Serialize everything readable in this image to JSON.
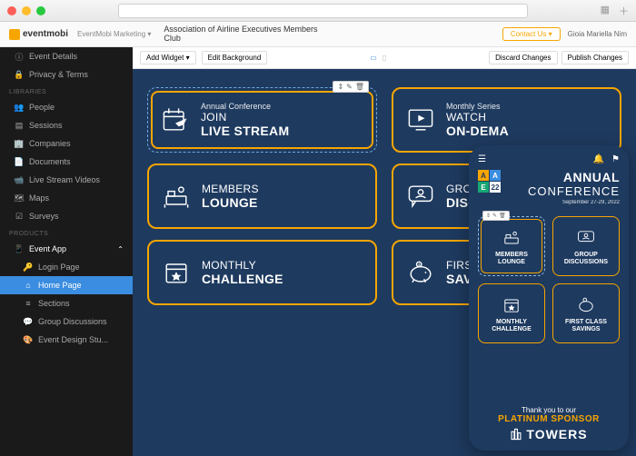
{
  "brand": "eventmobi",
  "breadcrumb": "EventMobi Marketing ▾",
  "event_name": "Association of Airline Executives Members Club",
  "topbar": {
    "contact": "Contact Us ▾",
    "user": "Gioia Mariella Nim"
  },
  "sidebar": {
    "main": [
      {
        "icon": "ⓘ",
        "label": "Event Details"
      },
      {
        "icon": "🔒",
        "label": "Privacy & Terms"
      }
    ],
    "libraries_label": "LIBRARIES",
    "libraries": [
      {
        "icon": "👥",
        "label": "People"
      },
      {
        "icon": "▤",
        "label": "Sessions"
      },
      {
        "icon": "🏢",
        "label": "Companies"
      },
      {
        "icon": "📄",
        "label": "Documents"
      },
      {
        "icon": "📹",
        "label": "Live Stream Videos"
      },
      {
        "icon": "🗺",
        "label": "Maps"
      },
      {
        "icon": "☑",
        "label": "Surveys"
      }
    ],
    "products_label": "PRODUCTS",
    "product_parent": {
      "icon": "📱",
      "label": "Event App"
    },
    "product_children": [
      {
        "icon": "🔑",
        "label": "Login Page",
        "active": false
      },
      {
        "icon": "⌂",
        "label": "Home Page",
        "active": true
      },
      {
        "icon": "≡",
        "label": "Sections",
        "active": false
      },
      {
        "icon": "💬",
        "label": "Group Discussions",
        "active": false
      },
      {
        "icon": "🎨",
        "label": "Event Design Stu...",
        "active": false
      }
    ]
  },
  "editor_toolbar": {
    "add_widget": "Add Widget ▾",
    "edit_bg": "Edit Background",
    "discard": "Discard Changes",
    "publish": "Publish Changes"
  },
  "tiles": [
    {
      "pre": "Annual Conference",
      "l1": "JOIN",
      "l2": "LIVE STREAM",
      "selected": true
    },
    {
      "pre": "Monthly Series",
      "l1": "WATCH",
      "l2": "ON-DEMA"
    },
    {
      "pre": "",
      "l1": "MEMBERS",
      "l2": "LOUNGE"
    },
    {
      "pre": "",
      "l1": "GROUP",
      "l2": "DISCUS"
    },
    {
      "pre": "",
      "l1": "MONTHLY",
      "l2": "CHALLENGE"
    },
    {
      "pre": "",
      "l1": "FIRST CL",
      "l2": "SAVINGS"
    }
  ],
  "phone": {
    "title_l1": "ANNUAL",
    "title_l2": "CONFERENCE",
    "dates": "September 27-29, 2022",
    "logo_cells": [
      "A",
      "A",
      "E",
      "22"
    ],
    "tiles": [
      {
        "l1": "MEMBERS",
        "l2": "LOUNGE",
        "selected": true
      },
      {
        "l1": "GROUP",
        "l2": "DISCUSSIONS"
      },
      {
        "l1": "MONTHLY",
        "l2": "CHALLENGE"
      },
      {
        "l1": "FIRST CLASS",
        "l2": "SAVINGS"
      }
    ],
    "sponsor_pre": "Thank you to our",
    "sponsor_tier": "PLATINUM SPONSOR",
    "sponsor_brand": "TOWERS"
  }
}
